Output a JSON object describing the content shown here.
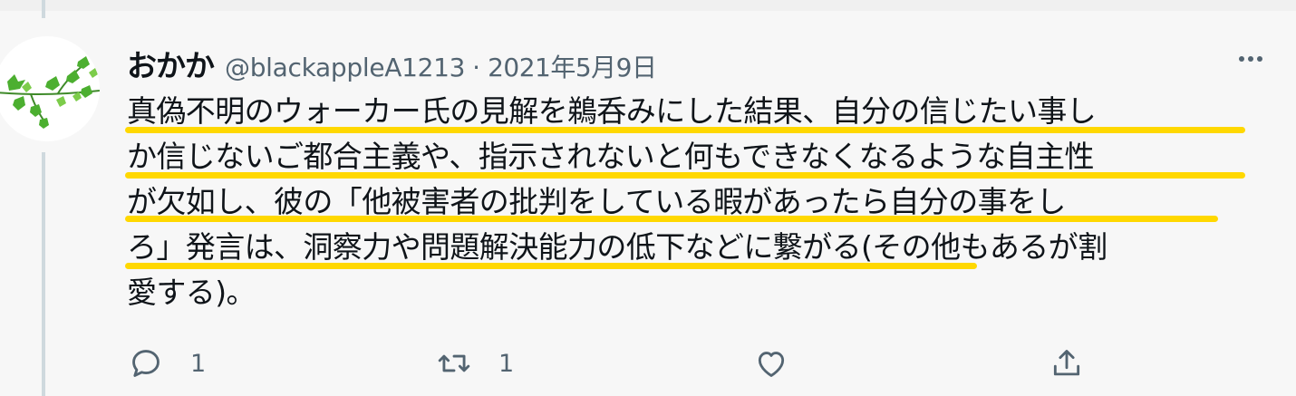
{
  "tweet": {
    "display_name": "おかか",
    "handle": "@blackappleA1213",
    "separator": "·",
    "date": "2021年5月9日",
    "text_lines": [
      "真偽不明のウォーカー氏の見解を鵜呑みにした結果、自分の信じたい事し",
      "か信じないご都合主義や、指示されないと何もできなくなるような自主性",
      "が欠如し、彼の「他被害者の批判をしている暇があったら自分の事をし",
      "ろ」発言は、洞察力や問題解決能力の低下などに繋がる(その他もあるが割",
      "愛する)。"
    ],
    "highlight_color": "#ffd800",
    "accent_gray": "#536471"
  },
  "actions": {
    "reply": {
      "icon": "reply-icon",
      "count": "1"
    },
    "retweet": {
      "icon": "retweet-icon",
      "count": "1"
    },
    "like": {
      "icon": "like-icon"
    },
    "share": {
      "icon": "share-icon"
    }
  }
}
